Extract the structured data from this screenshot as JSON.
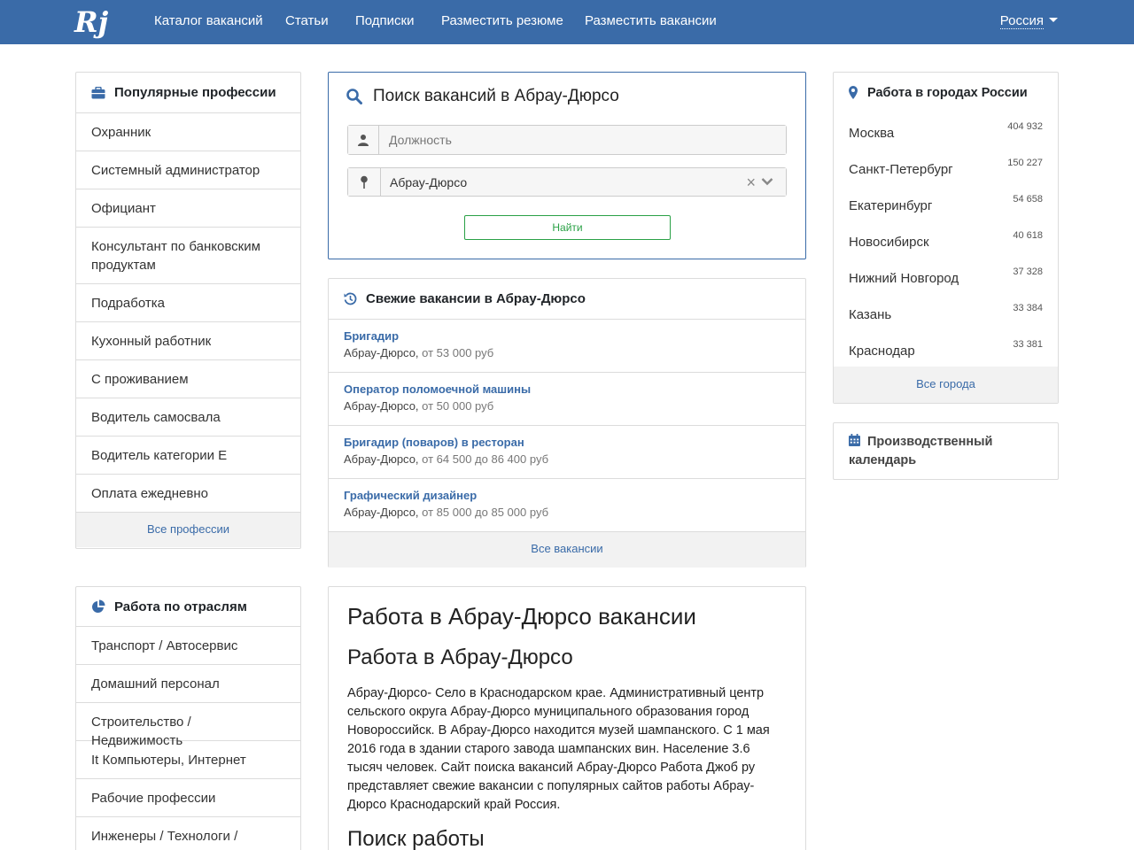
{
  "nav": {
    "logo_text": "Rj",
    "links": [
      "Каталог вакансий",
      "Статьи",
      "Подписки",
      "Разместить резюме",
      "Разместить вакансии"
    ],
    "country": "Россия"
  },
  "professions": {
    "title": "Популярные профессии",
    "items": [
      "Охранник",
      "Системный администратор",
      "Официант",
      "Консультант по банковским продуктам",
      "Подработка",
      "Кухонный работник",
      "С проживанием",
      "Водитель самосвала",
      "Водитель категории Е",
      "Оплата ежедневно"
    ],
    "footer": "Все профессии"
  },
  "industries": {
    "title": "Работа по отраслям",
    "items": [
      "Транспорт / Автосервис",
      "Домашний персонал",
      "Строительство / Недвижимость",
      "It Компьютеры, Интернет",
      "Рабочие профессии",
      "Инженеры / Технологи /"
    ]
  },
  "search": {
    "title": "Поиск вакансий в Абрау-Дюрсо",
    "position_placeholder": "Должность",
    "location_value": "Абрау-Дюрсо",
    "clear_symbol": "×",
    "button": "Найти"
  },
  "fresh": {
    "title": "Свежие вакансии в Абрау-Дюрсо",
    "items": [
      {
        "title": "Бригадир",
        "place": "Абрау-Дюрсо,",
        "salary": "от 53 000 руб"
      },
      {
        "title": "Оператор поломоечной машины",
        "place": "Абрау-Дюрсо,",
        "salary": "от 50 000 руб"
      },
      {
        "title": "Бригадир (поваров) в ресторан",
        "place": "Абрау-Дюрсо,",
        "salary": "от 64 500 до 86 400 руб"
      },
      {
        "title": "Графический дизайнер",
        "place": "Абрау-Дюрсо,",
        "salary": "от 85 000 до 85 000 руб"
      }
    ],
    "footer": "Все вакансии"
  },
  "article": {
    "h1": "Работа в Абрау-Дюрсо вакансии",
    "h2": "Работа в Абрау-Дюрсо",
    "paragraph": "Абрау-Дюрсо- Село в Краснодарском крае. Административный центр сельского округа Абрау-Дюрсо муниципального образования город Новороссийск. В Абрау-Дюрсо находится музей шампанского. С 1 мая 2016 года в здании старого завода шампанских вин. Население 3.6 тысяч человек. Сайт поиска вакансий Абрау-Дюрсо Работа Джоб ру представляет свежие вакансии с популярных сайтов работы Абрау-Дюрсо Краснодарский край Россия.",
    "h2b": "Поиск работы"
  },
  "cities": {
    "title": "Работа в городах России",
    "items": [
      {
        "name": "Москва",
        "count": "404 932"
      },
      {
        "name": "Санкт-Петербург",
        "count": "150 227"
      },
      {
        "name": "Екатеринбург",
        "count": "54 658"
      },
      {
        "name": "Новосибирск",
        "count": "40 618"
      },
      {
        "name": "Нижний Новгород",
        "count": "37 328"
      },
      {
        "name": "Казань",
        "count": "33 384"
      },
      {
        "name": "Краснодар",
        "count": "33 381"
      }
    ],
    "footer": "Все города"
  },
  "calendar": {
    "title": "Производственный календарь"
  },
  "colors": {
    "navbar": "#3a6ba8",
    "link": "#3a6ba8",
    "button_green": "#2aa146"
  },
  "icons": [
    "briefcase-icon",
    "pie-chart-icon",
    "search-icon",
    "user-icon",
    "map-pin-icon",
    "history-icon",
    "location-marker-icon",
    "calendar-icon",
    "chevron-down-icon"
  ]
}
